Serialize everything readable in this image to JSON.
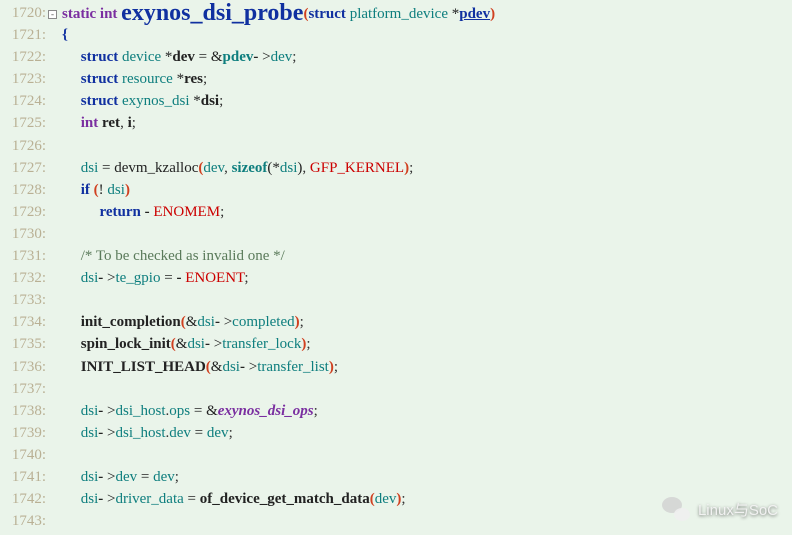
{
  "line_start": 1720,
  "line_end": 1743,
  "footer_text": "Linux与SoC",
  "code": [
    {
      "n": 1720,
      "html": "<span class='kw-purple-b'>static</span> <span class='kw-purple-b'>int</span> <span class='fn-big'>exynos_dsi_probe</span><span class='paren-red'>(</span><span class='kw-blue'>struct</span> <span class='id-teal'>platform_device</span> <span class='num'>*</span><span class='kw-blue underline'>pdev</span><span class='paren-red'>)</span>"
    },
    {
      "n": 1721,
      "html": "<span class='brace'>{</span>"
    },
    {
      "n": 1722,
      "html": "     <span class='kw-blue'>struct</span> <span class='id-teal'>device</span> <span class='num'>*</span><span class='dark-b'>dev</span> <span class='num'>=</span> <span class='num'>&amp;</span><span class='kw-teal-b'>pdev</span><span class='dark-b'>-</span> <span class='num'>&gt;</span><span class='id-teal'>dev</span>;"
    },
    {
      "n": 1723,
      "html": "     <span class='kw-blue'>struct</span> <span class='id-teal'>resource</span> <span class='num'>*</span><span class='dark-b'>res</span>;"
    },
    {
      "n": 1724,
      "html": "     <span class='kw-blue'>struct</span> <span class='id-teal'>exynos_dsi</span> <span class='num'>*</span><span class='dark-b'>dsi</span>;"
    },
    {
      "n": 1725,
      "html": "     <span class='kw-purple-b'>int</span> <span class='dark-b'>ret</span>, <span class='dark-b'>i</span>;"
    },
    {
      "n": 1726,
      "html": ""
    },
    {
      "n": 1727,
      "html": "     <span class='id-teal'>dsi</span> <span class='num'>=</span> <span class='num'>devm_kzalloc</span><span class='paren-red'>(</span><span class='id-teal'>dev</span>, <span class='kw-teal-b'>sizeof</span><span class='paren-dark'>(</span><span class='num'>*</span><span class='id-teal'>dsi</span><span class='paren-dark'>)</span>, <span class='macro-red'>GFP_KERNEL</span><span class='paren-red'>)</span>;"
    },
    {
      "n": 1728,
      "html": "     <span class='kw-blue'>if</span> <span class='paren-red'>(</span><span class='num'>!</span> <span class='id-teal'>dsi</span><span class='paren-red'>)</span>"
    },
    {
      "n": 1729,
      "html": "          <span class='kw-blue'>return</span> <span class='dark-b'>-</span> <span class='id-red'>ENOMEM</span>;"
    },
    {
      "n": 1730,
      "html": ""
    },
    {
      "n": 1731,
      "html": "     <span class='comment'>/* To be checked as invalid one */</span>"
    },
    {
      "n": 1732,
      "html": "     <span class='id-teal'>dsi</span><span class='dark-b'>-</span> <span class='num'>&gt;</span><span class='id-teal'>te_gpio</span> <span class='num'>=</span> <span class='dark-b'>-</span> <span class='id-red'>ENOENT</span>;"
    },
    {
      "n": 1733,
      "html": ""
    },
    {
      "n": 1734,
      "html": "     <span class='fn-dark-b'>init_completion</span><span class='paren-red'>(</span><span class='num'>&amp;</span><span class='id-teal'>dsi</span><span class='dark-b'>-</span> <span class='num'>&gt;</span><span class='id-teal'>completed</span><span class='paren-red'>)</span>;"
    },
    {
      "n": 1735,
      "html": "     <span class='fn-dark-b'>spin_lock_init</span><span class='paren-red'>(</span><span class='num'>&amp;</span><span class='id-teal'>dsi</span><span class='dark-b'>-</span> <span class='num'>&gt;</span><span class='id-teal'>transfer_lock</span><span class='paren-red'>)</span>;"
    },
    {
      "n": 1736,
      "html": "     <span class='fn-dark-b'>INIT_LIST_HEAD</span><span class='paren-red'>(</span><span class='num'>&amp;</span><span class='id-teal'>dsi</span><span class='dark-b'>-</span> <span class='num'>&gt;</span><span class='id-teal'>transfer_list</span><span class='paren-red'>)</span>;"
    },
    {
      "n": 1737,
      "html": ""
    },
    {
      "n": 1738,
      "html": "     <span class='id-teal'>dsi</span><span class='dark-b'>-</span> <span class='num'>&gt;</span><span class='id-teal'>dsi_host</span>.<span class='id-teal'>ops</span> <span class='num'>=</span> <span class='num'>&amp;</span><span class='id-italic'>exynos_dsi_ops</span>;"
    },
    {
      "n": 1739,
      "html": "     <span class='id-teal'>dsi</span><span class='dark-b'>-</span> <span class='num'>&gt;</span><span class='id-teal'>dsi_host</span>.<span class='id-teal'>dev</span> <span class='num'>=</span> <span class='id-teal'>dev</span>;"
    },
    {
      "n": 1740,
      "html": ""
    },
    {
      "n": 1741,
      "html": "     <span class='id-teal'>dsi</span><span class='dark-b'>-</span> <span class='num'>&gt;</span><span class='id-teal'>dev</span> <span class='num'>=</span> <span class='id-teal'>dev</span>;"
    },
    {
      "n": 1742,
      "html": "     <span class='id-teal'>dsi</span><span class='dark-b'>-</span> <span class='num'>&gt;</span><span class='id-teal'>driver_data</span> <span class='num'>=</span> <span class='fn-dark-b'>of_device_get_match_data</span><span class='paren-red'>(</span><span class='id-teal'>dev</span><span class='paren-red'>)</span>;"
    },
    {
      "n": 1743,
      "html": ""
    }
  ]
}
